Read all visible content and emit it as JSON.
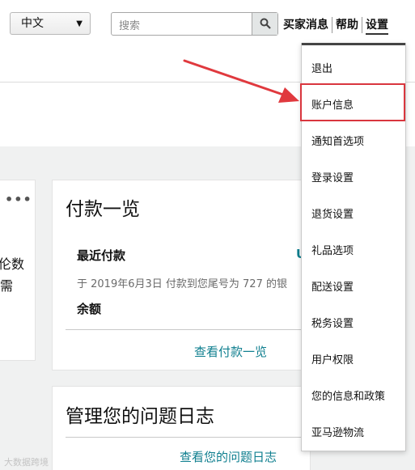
{
  "header": {
    "language": "中文",
    "search_placeholder": "搜索",
    "links": [
      "买家消息",
      "帮助",
      "设置"
    ]
  },
  "left_card": {
    "more": "•••",
    "text_line1": "伦数",
    "text_line2": "需"
  },
  "payment_card": {
    "title": "付款一览",
    "recent_label": "最近付款",
    "recent_detail": "于 2019年6月3日 付款到您尾号为 727 的银",
    "balance_label": "余额",
    "edge_text": "U",
    "view_link": "查看付款一览"
  },
  "issues_card": {
    "title": "管理您的问题日志",
    "view_link": "查看您的问题日志"
  },
  "settings_menu": {
    "items": [
      "退出",
      "账户信息",
      "通知首选项",
      "登录设置",
      "退货设置",
      "礼品选项",
      "配送设置",
      "税务设置",
      "用户权限",
      "您的信息和政策",
      "亚马逊物流"
    ],
    "highlighted": "账户信息"
  },
  "watermark": "大数据跨境",
  "colors": {
    "link": "#0f7f8f",
    "highlight": "#d9363e",
    "arrow": "#e0393e",
    "background_gray": "#f0f1f1"
  }
}
